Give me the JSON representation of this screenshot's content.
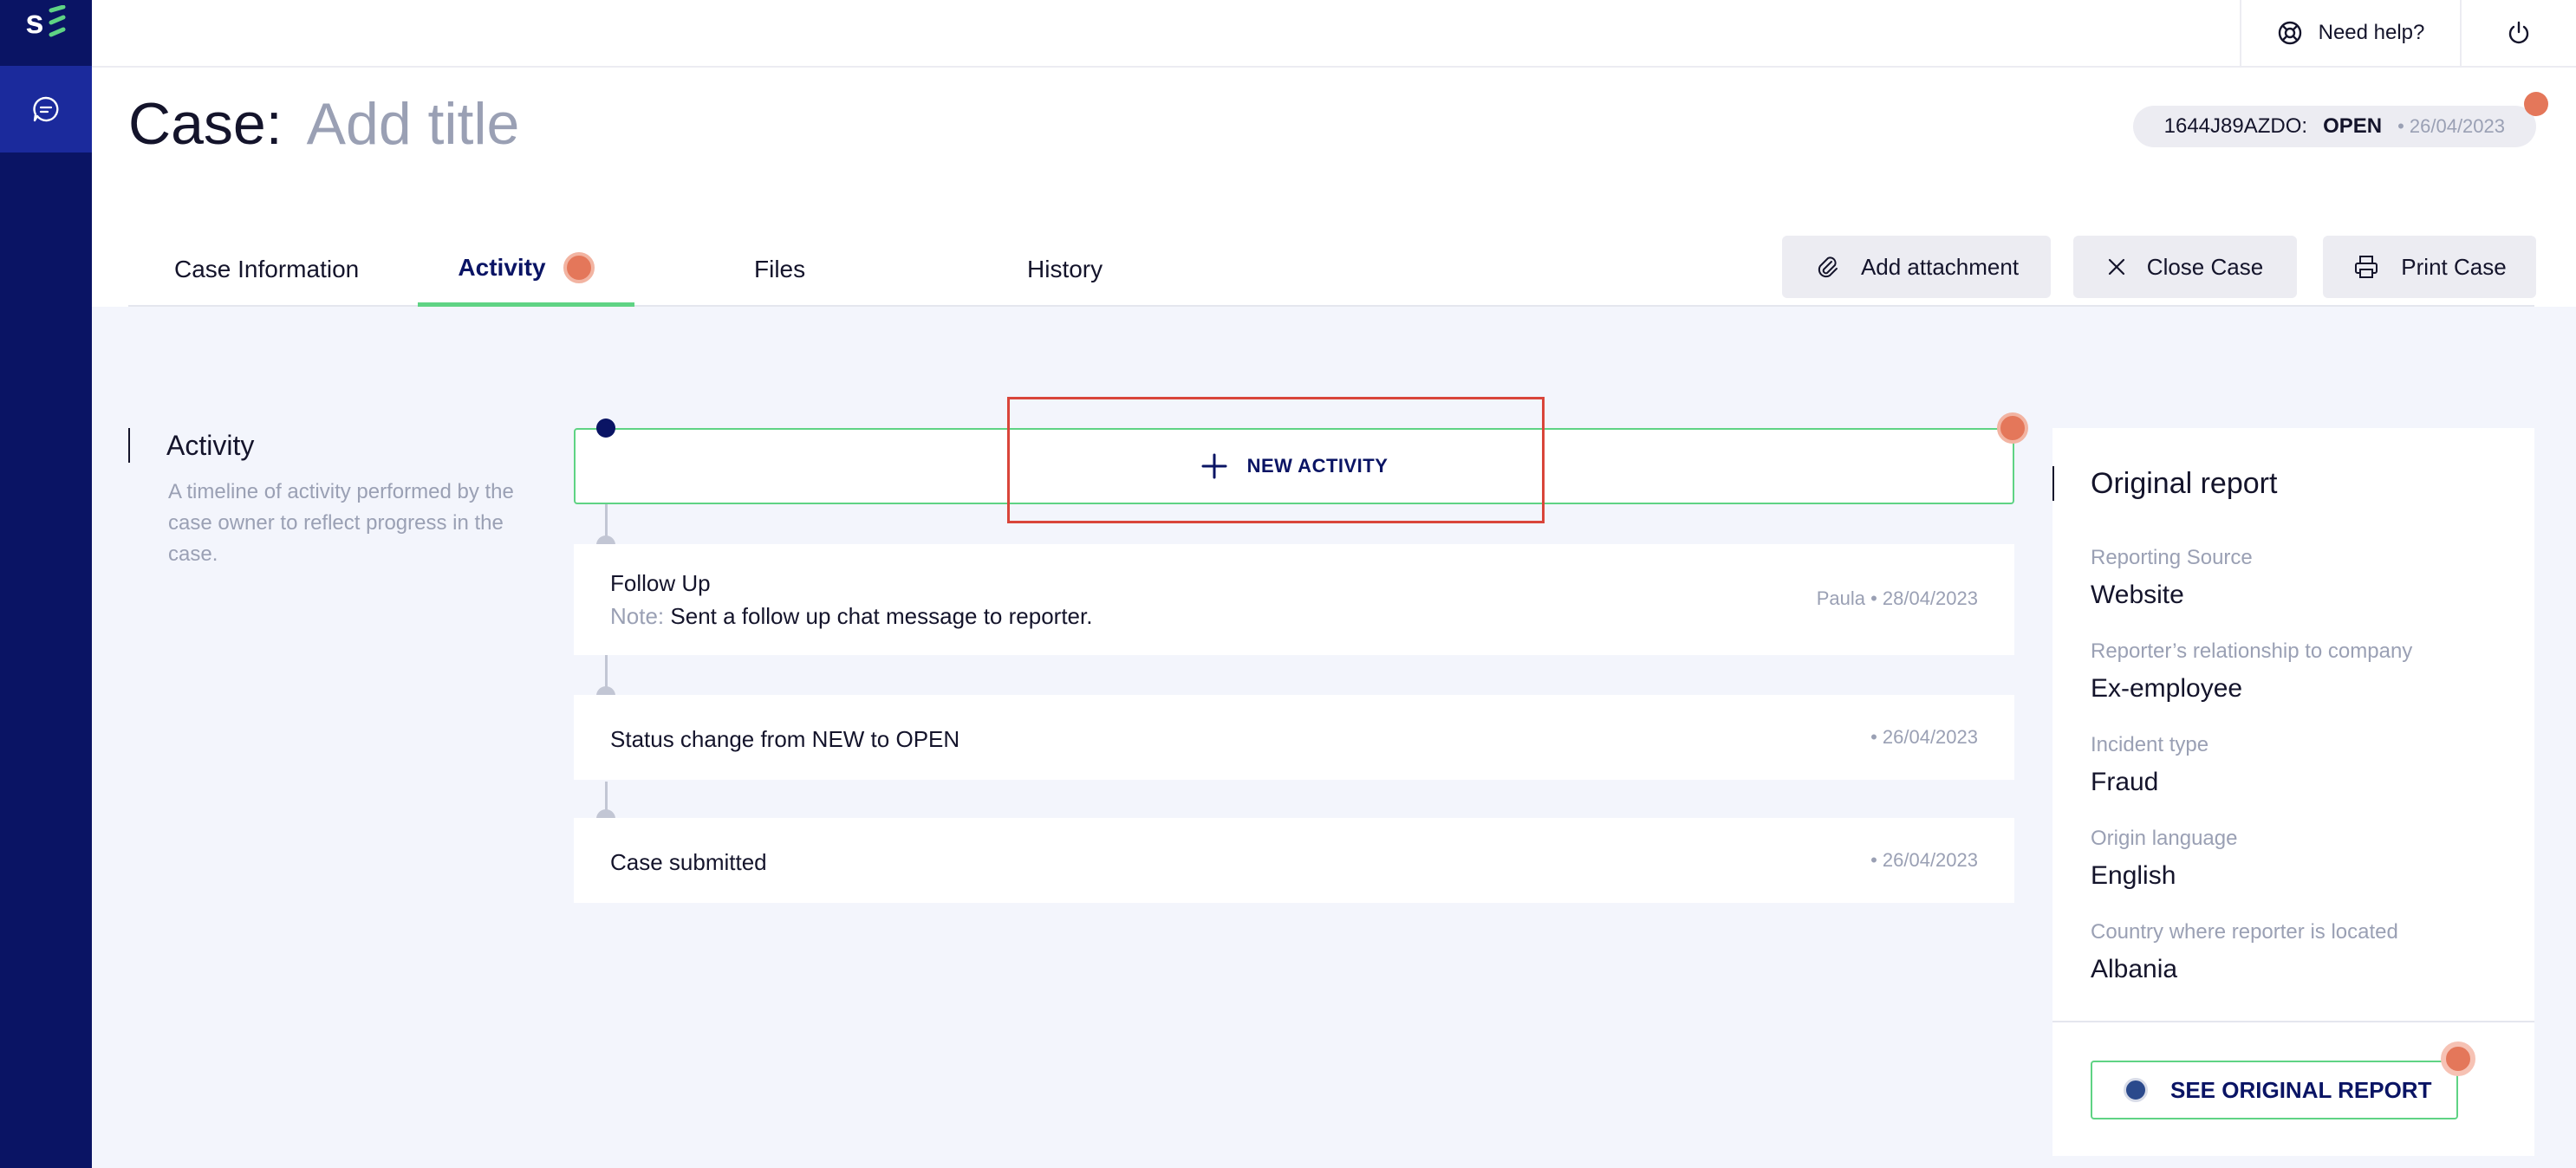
{
  "app": {
    "logo": "s",
    "accent": "#5fd384",
    "navy": "#0a1464",
    "alert": "#e4775a"
  },
  "sidebar": {
    "items": [
      {
        "icon": "chat-bubble-icon"
      }
    ]
  },
  "topbar": {
    "help_label": "Need help?",
    "help_icon": "lifebuoy-icon",
    "power_icon": "power-icon"
  },
  "header": {
    "title_label": "Case:",
    "title_placeholder": "Add title",
    "case_id": "1644J89AZDO:",
    "case_status": "OPEN",
    "case_date": "• 26/04/2023"
  },
  "tabs": [
    {
      "label": "Case Information"
    },
    {
      "label": "Activity",
      "active": true
    },
    {
      "label": "Files"
    },
    {
      "label": "History"
    }
  ],
  "actions": {
    "add_attachment": "Add attachment",
    "close_case": "Close Case",
    "print_case": "Print Case"
  },
  "activity_section": {
    "heading": "Activity",
    "description": "A timeline of activity performed by the case owner to reflect progress in the case.",
    "new_activity_label": "NEW ACTIVITY"
  },
  "timeline": [
    {
      "title": "Follow Up",
      "note_label": "Note:",
      "note_text": "Sent a follow up chat message to reporter.",
      "meta": "Paula • 28/04/2023"
    },
    {
      "title": "Status change from NEW to OPEN",
      "meta": "• 26/04/2023"
    },
    {
      "title": "Case submitted",
      "meta": "• 26/04/2023"
    }
  ],
  "original_report": {
    "heading": "Original report",
    "fields": [
      {
        "label": "Reporting Source",
        "value": "Website"
      },
      {
        "label": "Reporter’s relationship to company",
        "value": "Ex-employee"
      },
      {
        "label": "Incident type",
        "value": "Fraud"
      },
      {
        "label": "Origin language",
        "value": "English"
      },
      {
        "label": "Country where reporter is located",
        "value": "Albania"
      }
    ],
    "button_label": "SEE ORIGINAL REPORT"
  }
}
